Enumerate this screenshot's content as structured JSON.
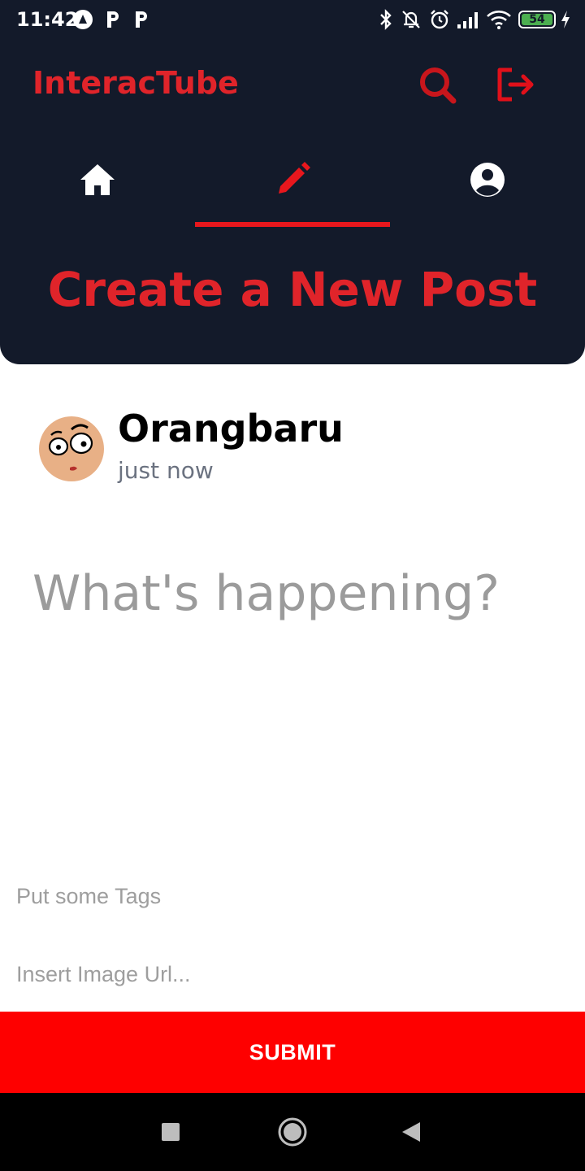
{
  "status_bar": {
    "time": "11:42",
    "battery": "54",
    "icons": [
      "notification-a-icon",
      "parking-icon",
      "parking-icon",
      "bluetooth-icon",
      "notifications-off-icon",
      "alarm-icon",
      "signal-icon",
      "wifi-icon",
      "battery-icon",
      "charging-icon"
    ]
  },
  "app_bar": {
    "title": "InteracTube",
    "icons": [
      "search-icon",
      "logout-icon"
    ]
  },
  "tabs": [
    {
      "icon": "home-icon",
      "selected": false
    },
    {
      "icon": "pencil-icon",
      "selected": true
    },
    {
      "icon": "account-icon",
      "selected": false
    }
  ],
  "page": {
    "title": "Create a New Post"
  },
  "composer": {
    "username": "Orangbaru",
    "timestamp": "just now",
    "placeholder": "What's happening?",
    "tags_placeholder": "Put some Tags",
    "image_url_placeholder": "Insert Image Url...",
    "submit_label": "SUBMIT"
  },
  "nav_bar": {
    "icons": [
      "recents-icon",
      "home-nav-icon",
      "back-icon"
    ]
  },
  "colors": {
    "header_bg": "#131a2a",
    "accent": "#e0242a",
    "submit_bg": "#fe0000"
  }
}
